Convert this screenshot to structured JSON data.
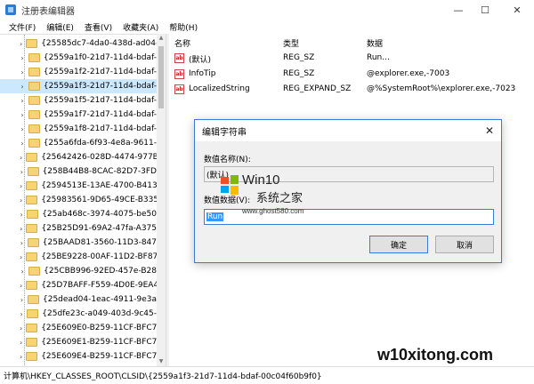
{
  "window": {
    "title": "注册表编辑器",
    "controls": {
      "minimize": "—",
      "maximize": "☐",
      "close": "✕"
    }
  },
  "menu": [
    "文件(F)",
    "编辑(E)",
    "查看(V)",
    "收藏夹(A)",
    "帮助(H)"
  ],
  "tree": {
    "items": [
      {
        "label": "{25585dc7-4da0-438d-ad04-",
        "selected": false
      },
      {
        "label": "{2559a1f0-21d7-11d4-bdaf-",
        "selected": false
      },
      {
        "label": "{2559a1f2-21d7-11d4-bdaf-",
        "selected": false
      },
      {
        "label": "{2559a1f3-21d7-11d4-bdaf-",
        "selected": true
      },
      {
        "label": "{2559a1f5-21d7-11d4-bdaf-",
        "selected": false
      },
      {
        "label": "{2559a1f7-21d7-11d4-bdaf-",
        "selected": false
      },
      {
        "label": "{2559a1f8-21d7-11d4-bdaf-",
        "selected": false
      },
      {
        "label": "{255a6fda-6f93-4e8a-9611-",
        "selected": false
      },
      {
        "label": "{25642426-028D-4474-977B",
        "selected": false
      },
      {
        "label": "{258B44B8-8CAC-82D7-3FD",
        "selected": false
      },
      {
        "label": "{2594513E-13AE-4700-B413",
        "selected": false
      },
      {
        "label": "{25983561-9D65-49CE-B335",
        "selected": false
      },
      {
        "label": "{25ab468c-3974-4075-be50",
        "selected": false
      },
      {
        "label": "{25B25D91-69A2-47fa-A375",
        "selected": false
      },
      {
        "label": "{25BAAD81-3560-11D3-847",
        "selected": false
      },
      {
        "label": "{25BE9228-00AF-11D2-BF87",
        "selected": false
      },
      {
        "label": "{25CBB996-92ED-457e-B28",
        "selected": false
      },
      {
        "label": "{25D7BAFF-F559-4D0E-9EA4",
        "selected": false
      },
      {
        "label": "{25dead04-1eac-4911-9e3a",
        "selected": false
      },
      {
        "label": "{25dfe23c-a049-403d-9c45-",
        "selected": false
      },
      {
        "label": "{25E609E0-B259-11CF-BFC7",
        "selected": false
      },
      {
        "label": "{25E609E1-B259-11CF-BFC7",
        "selected": false
      },
      {
        "label": "{25E609E4-B259-11CF-BFC7",
        "selected": false
      }
    ]
  },
  "values": {
    "headers": {
      "name": "名称",
      "type": "类型",
      "data": "数据"
    },
    "rows": [
      {
        "icon": "ab",
        "name": "(默认)",
        "type": "REG_SZ",
        "data": "Run..."
      },
      {
        "icon": "ab",
        "name": "InfoTip",
        "type": "REG_SZ",
        "data": "@explorer.exe,-7003"
      },
      {
        "icon": "ab",
        "name": "LocalizedString",
        "type": "REG_EXPAND_SZ",
        "data": "@%SystemRoot%\\explorer.exe,-7023"
      }
    ]
  },
  "dialog": {
    "title": "编辑字符串",
    "name_label": "数值名称(N):",
    "name_value": "(默认)",
    "data_label": "数值数据(V):",
    "data_value": "Run",
    "ok": "确定",
    "cancel": "取消",
    "close": "✕"
  },
  "statusbar": {
    "path": "计算机\\HKEY_CLASSES_ROOT\\CLSID\\{2559a1f3-21d7-11d4-bdaf-00c04f60b9f0}"
  },
  "watermarks": {
    "win10": "Win10",
    "system_home": "系统之家",
    "url": "www.ghost580.com",
    "bottom": "w10xitong.com"
  },
  "colors": {
    "accent": "#3a7bd5",
    "selection": "#cce8ff",
    "folder": "#f5d37a"
  }
}
